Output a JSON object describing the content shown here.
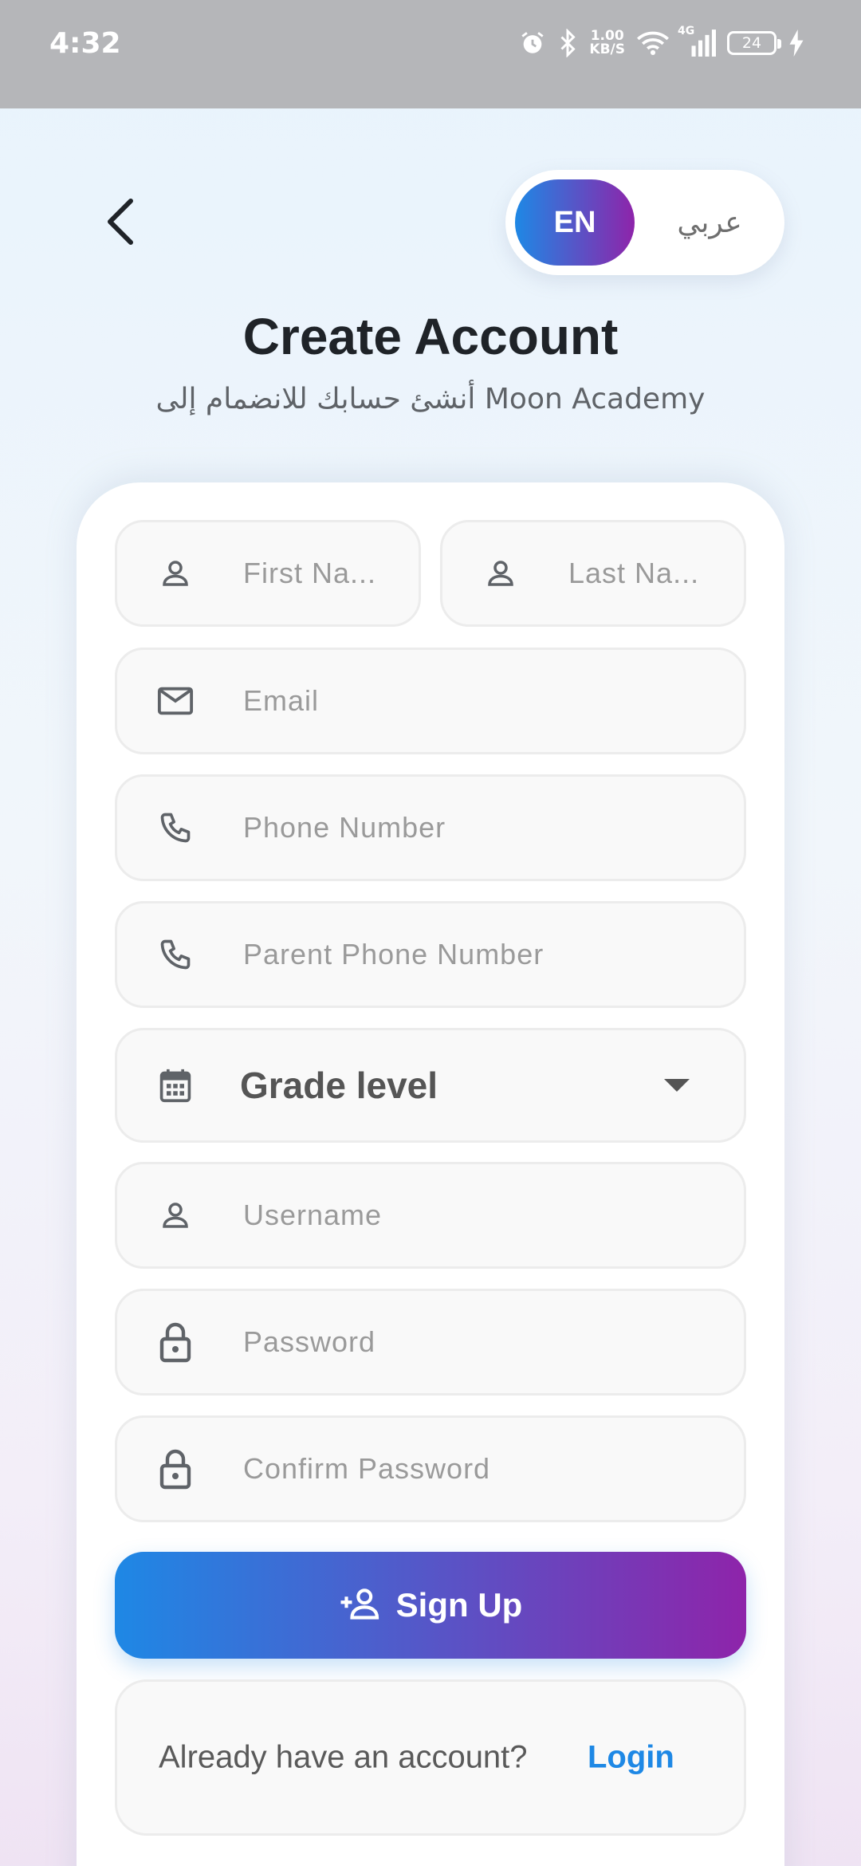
{
  "status_bar": {
    "time": "4:32",
    "net_speed_value": "1.00",
    "net_speed_unit": "KB/S",
    "network_type": "4G",
    "battery": "24"
  },
  "header": {
    "lang_en": "EN",
    "lang_ar": "عربي",
    "title": "Create Account",
    "subtitle": "أنشئ حسابك للانضمام إلى Moon Academy"
  },
  "form": {
    "first_name_placeholder": "First Na...",
    "last_name_placeholder": "Last Na...",
    "email_placeholder": "Email",
    "phone_placeholder": "Phone Number",
    "parent_phone_placeholder": "Parent Phone Number",
    "grade_level_value": "Grade level",
    "username_placeholder": "Username",
    "password_placeholder": "Password",
    "confirm_password_placeholder": "Confirm Password",
    "signup_label": "Sign Up"
  },
  "footer": {
    "login_question": "Already have an account?",
    "login_link": "Login"
  },
  "colors": {
    "accent_start": "#1e88e5",
    "accent_end": "#8e24aa",
    "link": "#1e88e5",
    "status_bar_bg": "#b5b6b9"
  }
}
